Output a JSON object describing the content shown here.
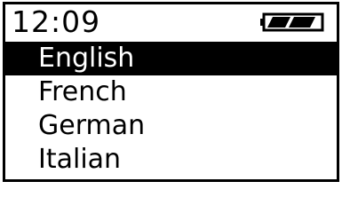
{
  "status_bar": {
    "time": "12:09",
    "battery_icon": "battery-full-icon"
  },
  "menu": {
    "items": [
      {
        "label": "English",
        "selected": true
      },
      {
        "label": "French",
        "selected": false
      },
      {
        "label": "German",
        "selected": false
      },
      {
        "label": "Italian",
        "selected": false
      }
    ]
  },
  "colors": {
    "foreground": "#000000",
    "background": "#ffffff"
  }
}
